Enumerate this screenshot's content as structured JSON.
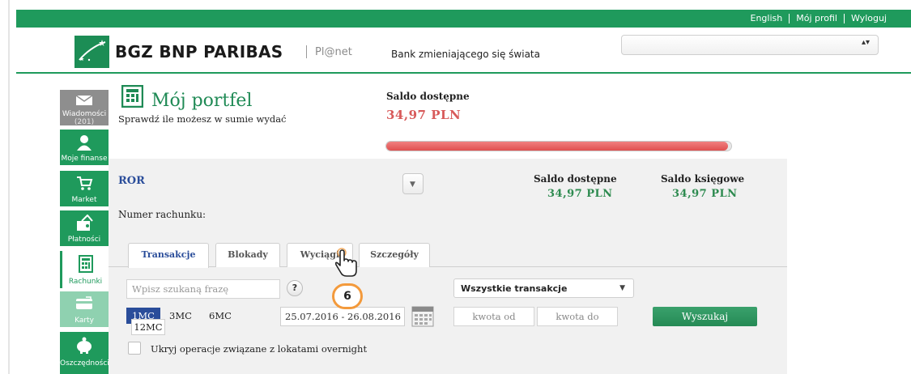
{
  "top_links": {
    "english": "English",
    "profile": "Mój profil",
    "logout": "Wyloguj"
  },
  "header": {
    "brand": "BGZ BNP PARIBAS",
    "product": "Pl@net",
    "tagline": "Bank zmieniającego się świata",
    "select_arrows": "▴▾"
  },
  "sidebar": {
    "items": [
      {
        "label": "Wiadomości",
        "count": "(201)",
        "icon": "envelope-icon"
      },
      {
        "label": "Moje finanse",
        "icon": "user-icon"
      },
      {
        "label": "Market",
        "icon": "cart-icon"
      },
      {
        "label": "Płatności",
        "icon": "payment-icon"
      },
      {
        "label": "Rachunki",
        "icon": "account-icon"
      },
      {
        "label": "Karty",
        "icon": "card-icon"
      },
      {
        "label": "Oszczędności",
        "icon": "piggy-icon"
      }
    ]
  },
  "portfolio": {
    "title": "Mój portfel",
    "subtitle": "Sprawdź ile możesz w sumie wydać",
    "available_label": "Saldo dostępne",
    "available_value": "34,97 PLN",
    "progress_percent": 99
  },
  "account": {
    "name": "ROR",
    "toggle": "▼",
    "available_label": "Saldo dostępne",
    "available_value": "34,97  PLN",
    "booked_label": "Saldo księgowe",
    "booked_value": "34,97  PLN",
    "number_label": "Numer rachunku:"
  },
  "tabs": [
    {
      "label": "Transakcje",
      "active": true
    },
    {
      "label": "Blokady",
      "active": false
    },
    {
      "label": "Wyciągi",
      "active": false
    },
    {
      "label": "Szczegóły",
      "active": false
    }
  ],
  "filters": {
    "search_placeholder": "Wpisz szukaną frazę",
    "help": "?",
    "type_selected": "Wszystkie transakcje",
    "type_arrow": "▼",
    "periods": [
      "1MC",
      "3MC",
      "6MC",
      "12MC"
    ],
    "date_range": "25.07.2016 - 26.08.2016",
    "amount_from": "kwota od",
    "amount_to": "kwota do",
    "search_button": "Wyszukaj",
    "overnight_label": "Ukryj operacje związane z lokatami overnight"
  },
  "annotation": {
    "step": "6"
  },
  "colors": {
    "brand_green": "#1f9a5c",
    "accent_blue": "#2a4d9a",
    "balance_red": "#d85a5a",
    "marker_orange": "#f39a3c"
  }
}
